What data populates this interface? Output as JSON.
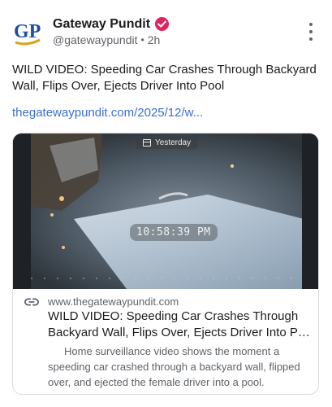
{
  "post": {
    "author_name": "Gateway Pundit",
    "handle": "@gatewaypundit",
    "time_ago": "2h",
    "avatar_text": "GP",
    "text": "WILD VIDEO: Speeding Car Crashes Through Backyard Wall, Flips Over, Ejects Driver Into Pool",
    "link": "thegatewaypundit.com/2025/12/w..."
  },
  "card": {
    "video_date_label": "Yesterday",
    "video_timestamp": "10:58:39 PM",
    "domain": "www.thegatewaypundit.com",
    "title_line1": "WILD VIDEO: Speeding Car Crashes Through",
    "title_line2": "Backyard Wall, Flips Over, Ejects Driver Into Po...",
    "description": "Home surveillance video shows the moment a speeding car crashed through a backyard wall, flipped over, and ejected the female driver into a pool."
  },
  "icons": {
    "verified": "verified-badge-icon",
    "menu": "more-vertical-icon",
    "link": "link-icon"
  },
  "colors": {
    "link_blue": "#3b6fd0",
    "verified_pink": "#e0245e",
    "avatar_blue": "#1f4fa5",
    "avatar_gold": "#d9a21b"
  }
}
